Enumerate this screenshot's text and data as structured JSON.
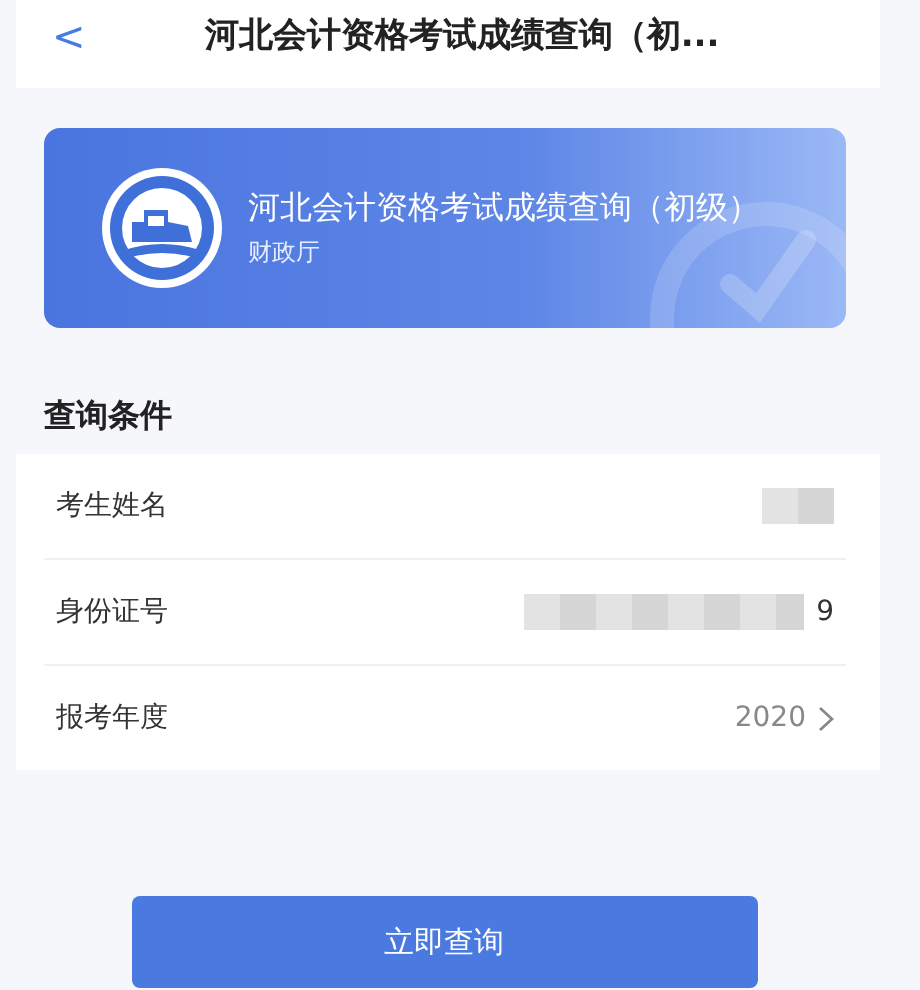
{
  "header": {
    "back": "<",
    "title": "河北会计资格考试成绩查询（初..."
  },
  "banner": {
    "title": "河北会计资格考试成绩查询（初级）",
    "subtitle": "财政厅"
  },
  "section_title": "查询条件",
  "fields": [
    {
      "kind": "text",
      "label": "考生姓名",
      "redacted": true
    },
    {
      "kind": "text",
      "label": "身份证号",
      "value": "9",
      "redacted": true
    },
    {
      "kind": "select",
      "label": "报考年度",
      "value": "2020"
    }
  ],
  "submit": "立即查询"
}
